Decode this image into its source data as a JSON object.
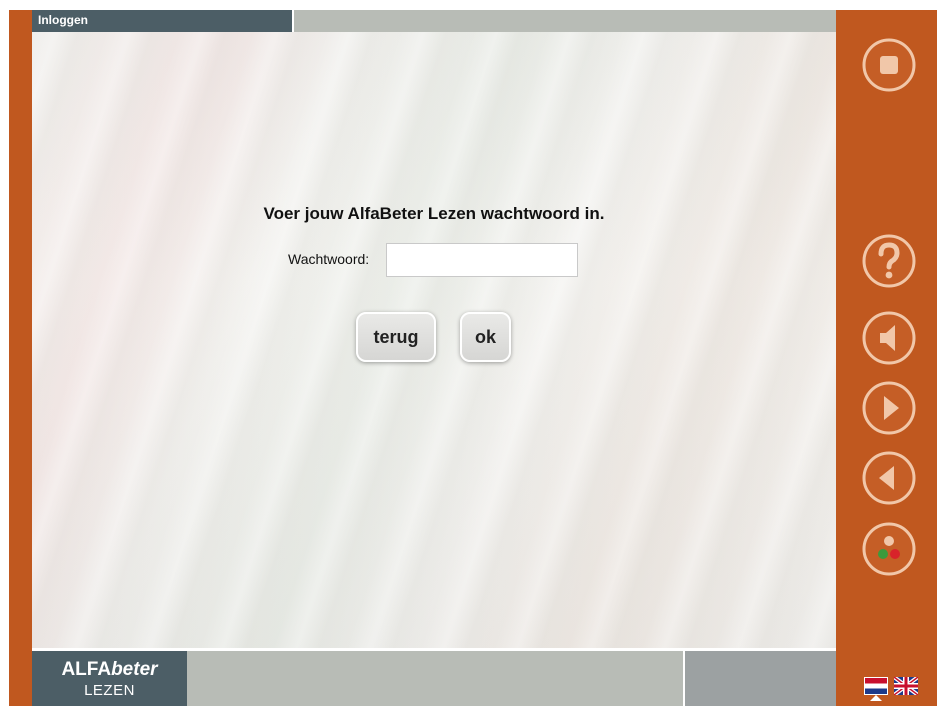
{
  "header": {
    "title": "Inloggen"
  },
  "main": {
    "prompt": "Voer jouw AlfaBeter Lezen wachtwoord in.",
    "password_label": "Wachtwoord:",
    "password_value": "",
    "buttons": {
      "back": "terug",
      "ok": "ok"
    }
  },
  "logo": {
    "line1_a": "ALFA",
    "line1_b": "beter",
    "line2": "LEZEN"
  },
  "side_controls": [
    {
      "icon": "stop-icon"
    },
    {
      "icon": "help-icon"
    },
    {
      "icon": "speaker-icon"
    },
    {
      "icon": "next-icon"
    },
    {
      "icon": "previous-icon"
    },
    {
      "icon": "status-dots-icon"
    }
  ],
  "colors": {
    "accent": "#c0581f",
    "title_bar": "#4c5e66",
    "bar_gray": "#b8bcb6",
    "footer_gray": "#9ca1a2",
    "dot_green": "#3c9a3c",
    "dot_red": "#d8232a"
  },
  "languages": [
    "nl-flag-icon",
    "uk-flag-icon"
  ]
}
